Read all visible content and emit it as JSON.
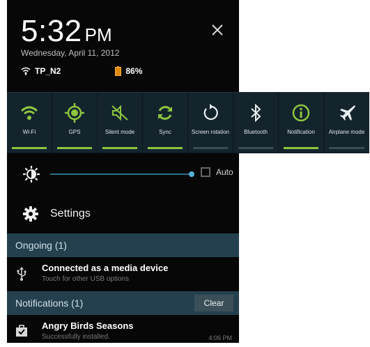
{
  "clock": {
    "time": "5:32",
    "ampm": "PM",
    "date": "Wednesday, April 11, 2012"
  },
  "status": {
    "wifi_name": "TP_N2",
    "battery": "86%"
  },
  "quick_settings": [
    {
      "label": "Wi-Fi",
      "icon": "wifi-icon",
      "on": true
    },
    {
      "label": "GPS",
      "icon": "gps-icon",
      "on": true
    },
    {
      "label": "Silent mode",
      "icon": "silent-mode-icon",
      "on": true
    },
    {
      "label": "Sync",
      "icon": "sync-icon",
      "on": true
    },
    {
      "label": "Screen rotation",
      "icon": "screen-rotation-icon",
      "on": false
    },
    {
      "label": "Bluetooth",
      "icon": "bluetooth-icon",
      "on": false
    },
    {
      "label": "Notification",
      "icon": "notification-icon",
      "on": true
    },
    {
      "label": "Airplane mode",
      "icon": "airplane-icon",
      "on": false
    }
  ],
  "brightness": {
    "auto_label": "Auto",
    "level": 1.0
  },
  "settings_label": "Settings",
  "ongoing": {
    "header": "Ongoing (1)",
    "item": {
      "title": "Connected as a media device",
      "subtitle": "Touch for other USB options"
    }
  },
  "notifications": {
    "header": "Notifications (1)",
    "clear_label": "Clear",
    "item": {
      "title": "Angry Birds Seasons",
      "subtitle": "Successfully installed.",
      "time": "4:06 PM"
    }
  },
  "colors": {
    "accent_green": "#8dc63f",
    "slider_blue": "#54b3d6",
    "section_bg": "#24404e"
  }
}
